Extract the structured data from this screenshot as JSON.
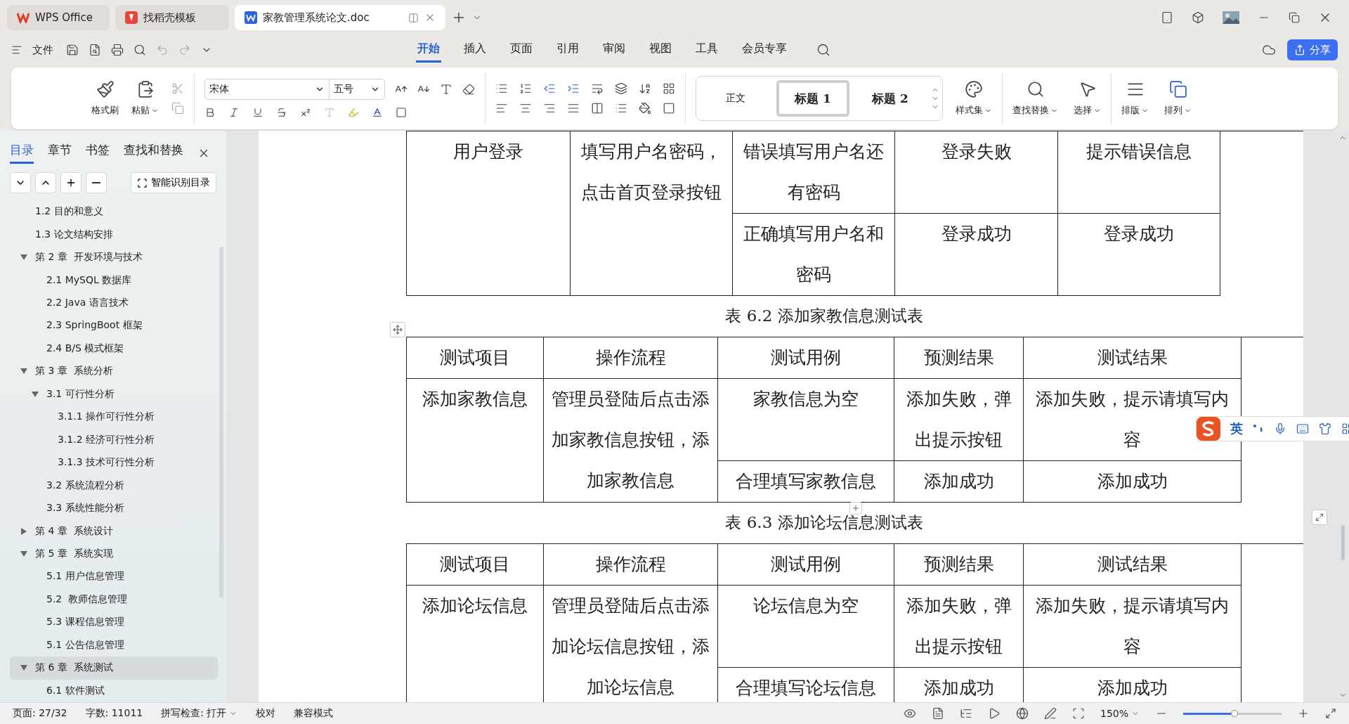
{
  "app_tabs": [
    {
      "label": "WPS Office",
      "kind": "home",
      "selected": false
    },
    {
      "label": "找稻壳模板",
      "kind": "templates",
      "selected": false
    },
    {
      "label": "家教管理系统论文.doc",
      "kind": "document",
      "selected": true
    }
  ],
  "quick_bar": {
    "file_menu": "文件"
  },
  "menu_tabs": [
    {
      "label": "开始",
      "selected": true
    },
    {
      "label": "插入",
      "selected": false
    },
    {
      "label": "页面",
      "selected": false
    },
    {
      "label": "引用",
      "selected": false
    },
    {
      "label": "审阅",
      "selected": false
    },
    {
      "label": "视图",
      "selected": false
    },
    {
      "label": "工具",
      "selected": false
    },
    {
      "label": "会员专享",
      "selected": false
    }
  ],
  "share_button": "分享",
  "ribbon": {
    "paint_format": "格式刷",
    "paste": "粘贴",
    "font_name": "宋体",
    "font_size": "五号",
    "styles": [
      {
        "label": "正文",
        "selected": false
      },
      {
        "label": "标题 1",
        "selected": true
      },
      {
        "label": "标题 2",
        "selected": false
      }
    ],
    "style_set": "样式集",
    "find_replace": "查找替换",
    "select": "选择",
    "layout": "排版",
    "arrange": "排列"
  },
  "nav_panel": {
    "tabs": [
      {
        "label": "目录",
        "selected": true
      },
      {
        "label": "章节",
        "selected": false
      },
      {
        "label": "书签",
        "selected": false
      },
      {
        "label": "查找和替换",
        "selected": false
      }
    ],
    "smart_toc_button": "智能识别目录",
    "outline": [
      {
        "label": "1.2 目的和意义",
        "selected": false
      },
      {
        "label": "1.3 论文结构安排",
        "selected": false
      },
      {
        "label": "第 2 章  开发环境与技术",
        "selected": false,
        "expanded": true,
        "children": [
          {
            "label": "2.1 MySQL 数据库",
            "selected": false
          },
          {
            "label": "2.2 Java 语言技术",
            "selected": false
          },
          {
            "label": "2.3 SpringBoot 框架",
            "selected": false
          },
          {
            "label": "2.4 B/S 模式框架",
            "selected": false
          }
        ]
      },
      {
        "label": "第 3 章  系统分析",
        "selected": false,
        "expanded": true,
        "children": [
          {
            "label": "3.1 可行性分析",
            "selected": false,
            "expanded": true,
            "children": [
              {
                "label": "3.1.1 操作可行性分析",
                "selected": false
              },
              {
                "label": "3.1.2 经济可行性分析",
                "selected": false
              },
              {
                "label": "3.1.3 技术可行性分析",
                "selected": false
              }
            ]
          },
          {
            "label": "3.2 系统流程分析",
            "selected": false
          },
          {
            "label": "3.3 系统性能分析",
            "selected": false
          }
        ]
      },
      {
        "label": "第 4 章  系统设计",
        "selected": false,
        "expanded": false
      },
      {
        "label": "第 5 章  系统实现",
        "selected": false,
        "expanded": true,
        "children": [
          {
            "label": "5.1 用户信息管理",
            "selected": false
          },
          {
            "label": "5.2  教师信息管理",
            "selected": false
          },
          {
            "label": "5.3 课程信息管理",
            "selected": false
          },
          {
            "label": "5.1 公告信息管理",
            "selected": false
          }
        ]
      },
      {
        "label": "第 6 章  系统测试",
        "selected": true,
        "expanded": true,
        "children": [
          {
            "label": "6.1 软件测试",
            "selected": false
          }
        ]
      }
    ]
  },
  "document": {
    "blocks": [
      {
        "kind": "table",
        "active": false,
        "cases": [
          {
            "item": "用户登录",
            "steps": "填写用户名密码，点击首页登录按钮",
            "variants": [
              {
                "input": "错误填写用户名还有密码",
                "expected": "登录失败",
                "result": "提示错误信息"
              },
              {
                "input": "正确填写用户名和密码",
                "expected": "登录成功",
                "result": "登录成功"
              }
            ]
          }
        ]
      },
      {
        "kind": "caption",
        "text": "表 6.2 添加家教信息测试表"
      },
      {
        "kind": "table",
        "active": true,
        "columns": [
          "测试项目",
          "操作流程",
          "测试用例",
          "预测结果",
          "测试结果"
        ],
        "cases": [
          {
            "item": "添加家教信息",
            "steps": "管理员登陆后点击添加家教信息按钮，添加家教信息",
            "variants": [
              {
                "input": "家教信息为空",
                "expected": "添加失败，弹出提示按钮",
                "result": "添加失败，提示请填写内容"
              },
              {
                "input": "合理填写家教信息",
                "expected": "添加成功",
                "result": "添加成功"
              }
            ]
          }
        ]
      },
      {
        "kind": "caption",
        "text": "表 6.3 添加论坛信息测试表"
      },
      {
        "kind": "table",
        "active": false,
        "columns": [
          "测试项目",
          "操作流程",
          "测试用例",
          "预测结果",
          "测试结果"
        ],
        "cases": [
          {
            "item": "添加论坛信息",
            "steps": "管理员登陆后点击添加论坛信息按钮，添加论坛信息",
            "variants": [
              {
                "input": "论坛信息为空",
                "expected": "添加失败，弹出提示按钮",
                "result": "添加失败，提示请填写内容"
              },
              {
                "input": "合理填写论坛信息",
                "expected": "添加成功",
                "result": "添加成功"
              }
            ]
          }
        ]
      }
    ]
  },
  "ime_bar": {
    "mode": "英"
  },
  "status_bar": {
    "page": "页面: 27/32",
    "words": "字数: 11011",
    "spell_check": "拼写检查: 打开",
    "proofread": "校对",
    "compat_mode": "兼容模式",
    "zoom": "150%",
    "zoom_slider": {
      "level": 0.52
    }
  }
}
